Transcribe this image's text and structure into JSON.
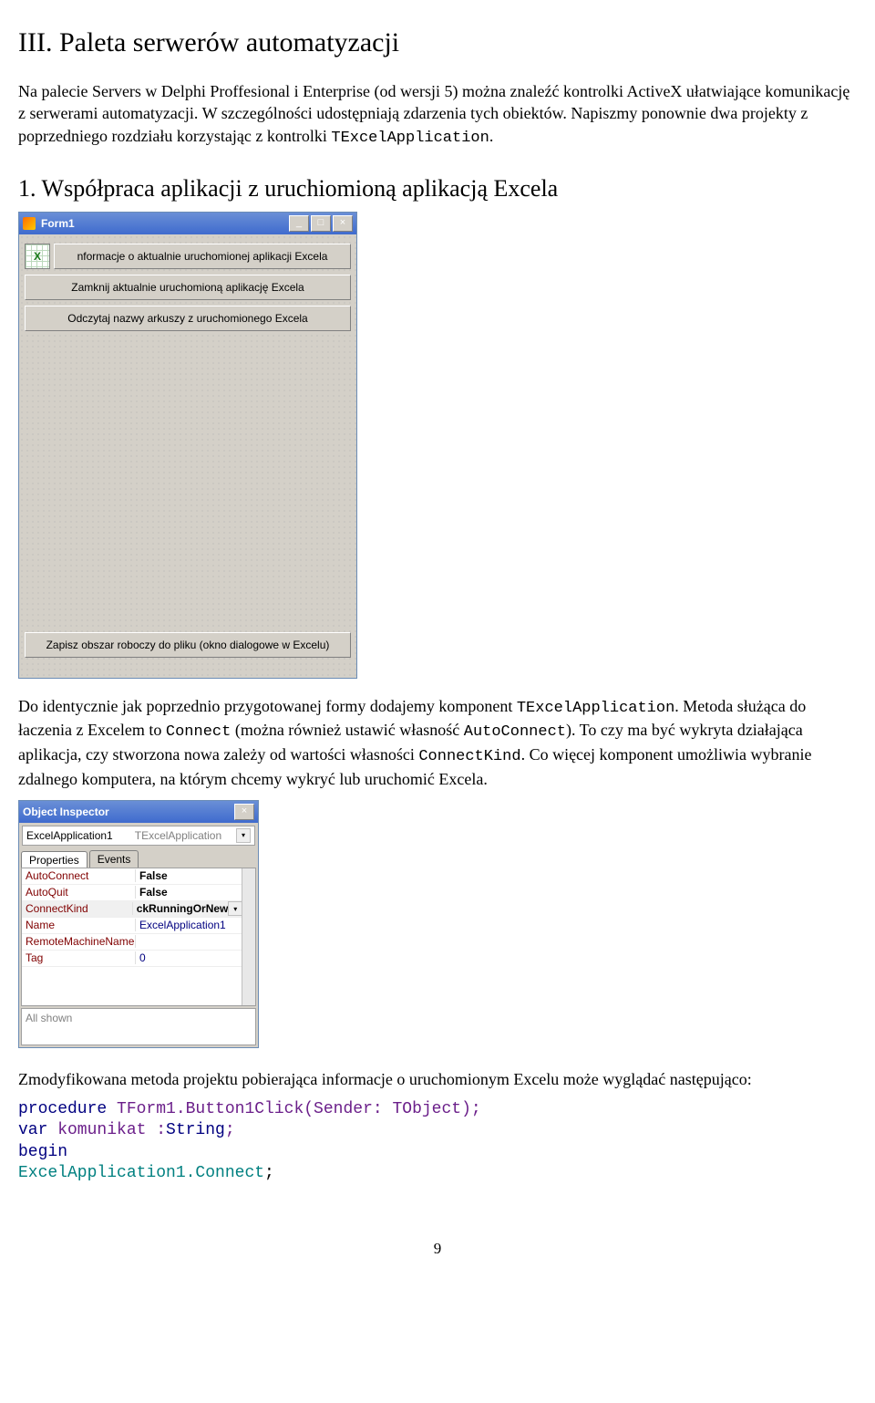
{
  "headings": {
    "main": "III. Paleta serwerów automatyzacji",
    "sub1": "1. Współpraca aplikacji z uruchiomioną aplikacją Excela"
  },
  "paragraphs": {
    "intro_a": "Na palecie Servers w Delphi Proffesional i Enterprise (od wersji 5) można znaleźć kontrolki ActiveX ułatwiające komunikację z serwerami automatyzacji. W szczególności udostępniają zdarzenia tych obiektów. Napiszmy ponownie dwa projekty z poprzedniego rozdziału korzystając z kontrolki ",
    "intro_code": "TExcelApplication",
    "intro_b": ".",
    "mid_a": "Do identycznie jak poprzednio przygotowanej formy dodajemy komponent ",
    "mid_code1": "TExcelApplication",
    "mid_b": ". Metoda służąca do łaczenia z Excelem to ",
    "mid_code2": "Connect",
    "mid_c": " (można również ustawić własność ",
    "mid_code3": "AutoConnect",
    "mid_d": "). To czy ma być wykryta działająca aplikacja, czy stworzona nowa zależy od wartości własności ",
    "mid_code4": "ConnectKind",
    "mid_e": ". Co więcej komponent umożliwia wybranie zdalnego komputera, na którym chcemy wykryć lub uruchomić Excela.",
    "outro": "Zmodyfikowana metoda projektu pobierająca informacje o uruchomionym Excelu może wyglądać następująco:"
  },
  "form1": {
    "title": "Form1",
    "btn1": "nformacje o aktualnie uruchomionej aplikacji Excela",
    "btn2": "Zamknij aktualnie uruchomioną aplikację Excela",
    "btn3": "Odczytaj nazwy arkuszy z uruchomionego Excela",
    "btn4": "Zapisz obszar roboczy do pliku (okno dialogowe w Excelu)",
    "excel_icon_label": "X",
    "minimize": "_",
    "maximize": "□",
    "close": "×"
  },
  "oi": {
    "title": "Object Inspector",
    "close": "×",
    "selected": "ExcelApplication1",
    "type": "TExcelApplication",
    "tab_props": "Properties",
    "tab_events": "Events",
    "rows": [
      {
        "k": "AutoConnect",
        "v": "False"
      },
      {
        "k": "AutoQuit",
        "v": "False"
      },
      {
        "k": "ConnectKind",
        "v": "ckRunningOrNew"
      },
      {
        "k": "Name",
        "v": "ExcelApplication1"
      },
      {
        "k": "RemoteMachineName",
        "v": ""
      },
      {
        "k": "Tag",
        "v": "0"
      }
    ],
    "footer": "All shown"
  },
  "code": {
    "l1a": "procedure",
    "l1b": " TForm1.Button1Click(Sender: TObject);",
    "l2a": "var",
    "l2b": " komunikat :",
    "l2c": "String",
    "l2d": ";",
    "l3": "begin",
    "l4a": "ExcelApplication1.Connect",
    "l4b": ";"
  },
  "page_number": "9"
}
